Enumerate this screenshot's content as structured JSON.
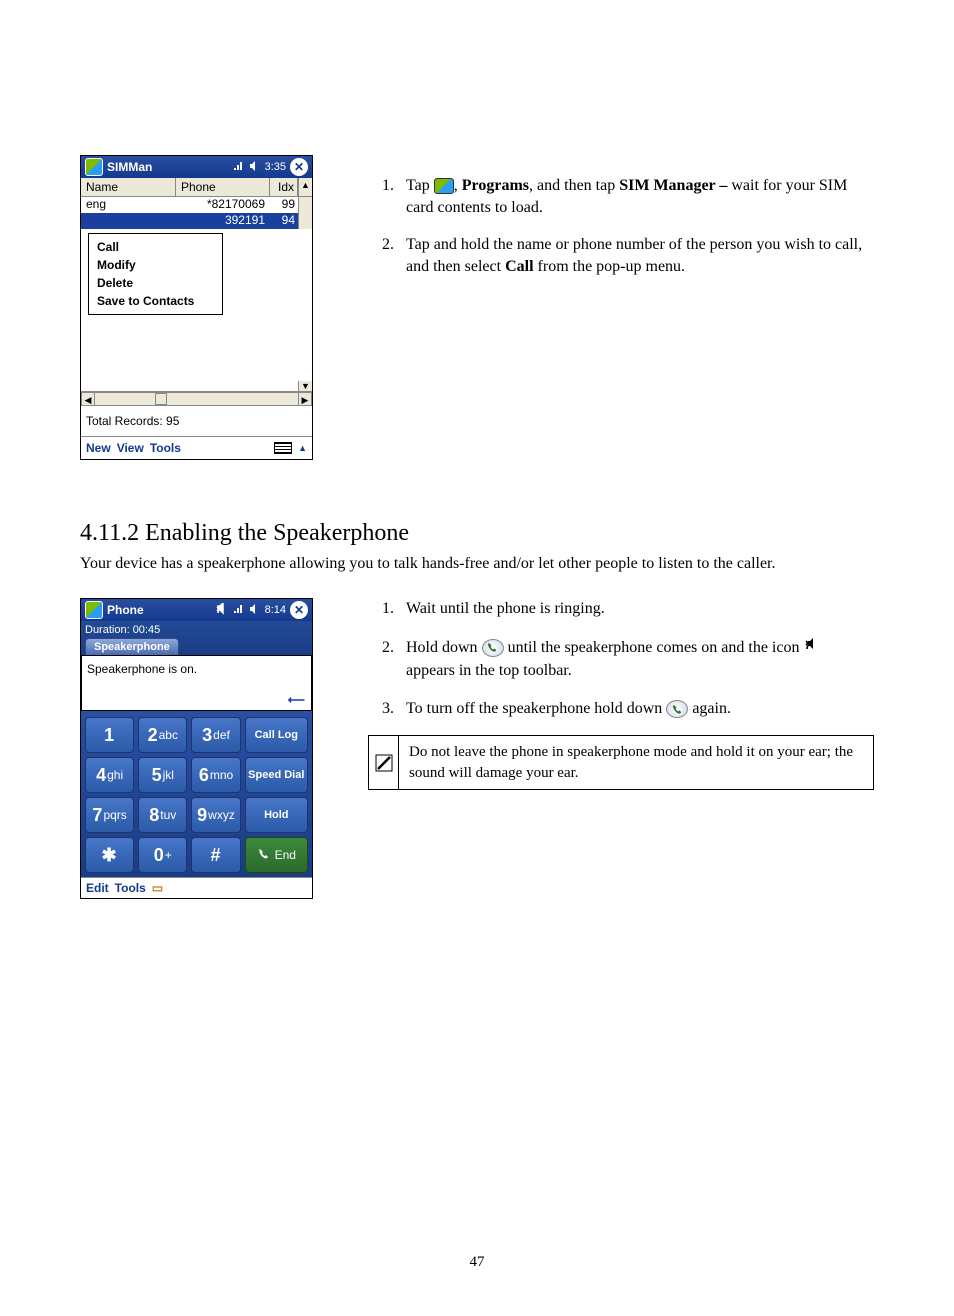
{
  "device1": {
    "title": "SIMMan",
    "time": "3:35",
    "headers": {
      "name": "Name",
      "phone": "Phone",
      "idx": "Idx"
    },
    "rows": [
      {
        "name": "eng",
        "phone": "*82170069",
        "idx": "99"
      },
      {
        "name": "",
        "phone": "392191",
        "idx": "94"
      }
    ],
    "popup": [
      "Call",
      "Modify",
      "Delete",
      "Save to Contacts"
    ],
    "total_label": "Total Records: 95",
    "menu": {
      "new": "New",
      "view": "View",
      "tools": "Tools"
    }
  },
  "instr1": {
    "step1_pre": "Tap ",
    "step1_mid": ", ",
    "step1_programs": "Programs",
    "step1_mid2": ", and then tap ",
    "step1_sim": "SIM Manager – ",
    "step1_post": "wait for your SIM card contents to load.",
    "step2_pre": "Tap and hold the name or phone number of the person you wish to call, and then select ",
    "step2_call": "Call",
    "step2_post": " from the pop-up menu."
  },
  "section": {
    "heading": "4.11.2  Enabling the Speakerphone",
    "sub": "Your device has a speakerphone allowing you to talk hands-free and/or let other people to listen to the caller."
  },
  "device2": {
    "title": "Phone",
    "time": "8:14",
    "duration": "Duration: 00:45",
    "tab": "Speakerphone",
    "msg": "Speakerphone is on.",
    "keys": {
      "1": "1",
      "2": "2",
      "2t": "abc",
      "3": "3",
      "3t": "def",
      "4": "4",
      "4t": "ghi",
      "5": "5",
      "5t": "jkl",
      "6": "6",
      "6t": "mno",
      "7": "7",
      "7t": "pqrs",
      "8": "8",
      "8t": "tuv",
      "9": "9",
      "9t": "wxyz",
      "star": "✱",
      "0": "0",
      "0t": "+",
      "hash": "#"
    },
    "func": {
      "calllog": "Call Log",
      "speeddial": "Speed Dial",
      "hold": "Hold",
      "end": "End"
    },
    "menu": {
      "edit": "Edit",
      "tools": "Tools"
    }
  },
  "instr2": {
    "step1": "Wait until the phone is ringing.",
    "step2_pre": "Hold down ",
    "step2_mid": " until the speakerphone comes on and the icon ",
    "step2_post": " appears in the top toolbar.",
    "step3_pre": "To turn off the speakerphone hold down ",
    "step3_post": " again."
  },
  "note": "Do not leave the phone in speakerphone mode and hold it on your ear; the sound will damage your ear.",
  "page_num": "47"
}
